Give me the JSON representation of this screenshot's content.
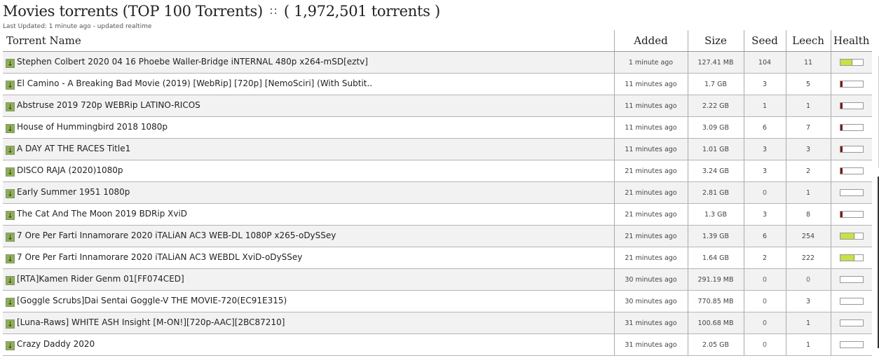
{
  "header": {
    "title_main": "Movies torrents (TOP 100 Torrents)",
    "rss_icon": "rss-icon",
    "title_count": "( 1,972,501 torrents )",
    "last_updated": "Last Updated: 1 minute ago - updated realtime"
  },
  "table": {
    "columns": [
      "Torrent Name",
      "Added",
      "Size",
      "Seed",
      "Leech",
      "Health"
    ],
    "download_icon": "download-icon",
    "colors": {
      "health_good": "#c8e04a",
      "health_bad": "#7a1a1a",
      "seed": "#2e7d32",
      "leech": "#8b1a1a"
    },
    "rows": [
      {
        "name": "Stephen Colbert 2020 04 16 Phoebe Waller-Bridge iNTERNAL 480p x264-mSD[eztv]",
        "added": "1 minute ago",
        "size": "127.41 MB",
        "seed": "104",
        "leech": "11",
        "health": 0.5
      },
      {
        "name": "El Camino - A Breaking Bad Movie (2019) [WebRip] [720p] [NemoSciri] (With Subtit..",
        "added": "11 minutes ago",
        "size": "1.7 GB",
        "seed": "3",
        "leech": "5",
        "health": 0.1
      },
      {
        "name": "Abstruse 2019 720p WEBRip LATINO-RICOS",
        "added": "11 minutes ago",
        "size": "2.22 GB",
        "seed": "1",
        "leech": "1",
        "health": 0.1
      },
      {
        "name": "House of Hummingbird 2018 1080p",
        "added": "11 minutes ago",
        "size": "3.09 GB",
        "seed": "6",
        "leech": "7",
        "health": 0.1
      },
      {
        "name": "A DAY AT THE RACES Title1",
        "added": "11 minutes ago",
        "size": "1.01 GB",
        "seed": "3",
        "leech": "3",
        "health": 0.1
      },
      {
        "name": "DISCO RAJA (2020)1080p",
        "added": "21 minutes ago",
        "size": "3.24 GB",
        "seed": "3",
        "leech": "2",
        "health": 0.1
      },
      {
        "name": "Early Summer 1951 1080p",
        "added": "21 minutes ago",
        "size": "2.81 GB",
        "seed": "0",
        "leech": "1",
        "health": 0
      },
      {
        "name": "The Cat And The Moon 2019 BDRip XviD",
        "added": "21 minutes ago",
        "size": "1.3 GB",
        "seed": "3",
        "leech": "8",
        "health": 0.1
      },
      {
        "name": "7 Ore Per Farti Innamorare 2020 iTALiAN AC3 WEB-DL 1080P x265-oDySSey",
        "added": "21 minutes ago",
        "size": "1.39 GB",
        "seed": "6",
        "leech": "254",
        "health": 0.6
      },
      {
        "name": "7 Ore Per Farti Innamorare 2020 iTALiAN AC3 WEBDL XviD-oDySSey",
        "added": "21 minutes ago",
        "size": "1.64 GB",
        "seed": "2",
        "leech": "222",
        "health": 0.6
      },
      {
        "name": "[RTA]Kamen Rider Genm 01[FF074CED]",
        "added": "30 minutes ago",
        "size": "291.19 MB",
        "seed": "0",
        "leech": "0",
        "health": 0
      },
      {
        "name": "[Goggle Scrubs]Dai Sentai Goggle-V THE MOVIE-720(EC91E315)",
        "added": "30 minutes ago",
        "size": "770.85 MB",
        "seed": "0",
        "leech": "3",
        "health": 0
      },
      {
        "name": "[Luna-Raws] WHITE ASH Insight [M-ON!][720p-AAC][2BC87210]",
        "added": "31 minutes ago",
        "size": "100.68 MB",
        "seed": "0",
        "leech": "1",
        "health": 0
      },
      {
        "name": "Crazy Daddy 2020",
        "added": "31 minutes ago",
        "size": "2.05 GB",
        "seed": "0",
        "leech": "1",
        "health": 0
      }
    ]
  }
}
